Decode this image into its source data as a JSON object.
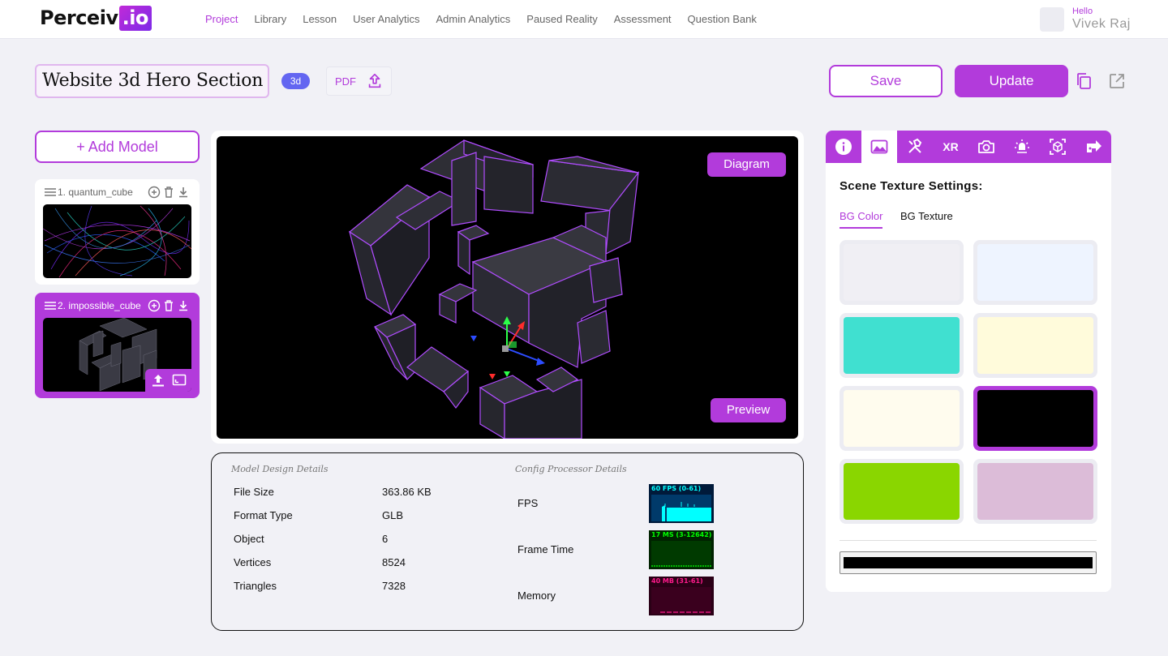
{
  "nav": {
    "logo_main": "Perceiv",
    "logo_suffix": ".io",
    "links": [
      "Project",
      "Library",
      "Lesson",
      "User Analytics",
      "Admin Analytics",
      "Paused Reality",
      "Assessment",
      "Question Bank"
    ],
    "active_link": "Project",
    "greeting": "Hello",
    "user_name": "Vivek Raj"
  },
  "project": {
    "title": "Website 3d Hero Section",
    "type_badge": "3d",
    "pdf_label": "PDF",
    "save_label": "Save",
    "update_label": "Update"
  },
  "models": {
    "add_label": "+ Add Model",
    "items": [
      {
        "label": "1. quantum_cube",
        "selected": false
      },
      {
        "label": "2. impossible_cube",
        "selected": true
      }
    ]
  },
  "viewer": {
    "diagram_label": "Diagram",
    "preview_label": "Preview"
  },
  "details": {
    "model_title": "Model Design Details",
    "config_title": "Config Processor Details",
    "model_rows": [
      {
        "label": "File Size",
        "value": "363.86 KB"
      },
      {
        "label": "Format Type",
        "value": "GLB"
      },
      {
        "label": "Object",
        "value": "6"
      },
      {
        "label": "Vertices",
        "value": "8524"
      },
      {
        "label": "Triangles",
        "value": "7328"
      }
    ],
    "config_rows": [
      {
        "label": "FPS",
        "graph_text": "60 FPS (0-61)",
        "fg": "#00ffff",
        "bg": "#001a3a"
      },
      {
        "label": "Frame Time",
        "graph_text": "17 MS (3-12642)",
        "fg": "#00ff00",
        "bg": "#002200"
      },
      {
        "label": "Memory",
        "graph_text": "40 MB (31-61)",
        "fg": "#ff1a8c",
        "bg": "#2a0016"
      }
    ]
  },
  "settings": {
    "tabs": [
      "info-icon",
      "image-icon",
      "tools-icon",
      "XR",
      "camera-icon",
      "light-icon",
      "focus-icon",
      "move-icon"
    ],
    "active_tab": 1,
    "title": "Scene Texture Settings:",
    "subtabs": [
      "BG Color",
      "BG Texture"
    ],
    "active_subtab": 0,
    "swatches": [
      "#f0eff4",
      "#eef4ff",
      "#40e0d0",
      "#fffbdb",
      "#fffcee",
      "#000000",
      "#8ad600",
      "#dcbcd8"
    ],
    "selected_swatch": 5,
    "current_color": "#000000"
  },
  "colors": {
    "accent": "#b23bdb",
    "badge": "#6366f1"
  }
}
